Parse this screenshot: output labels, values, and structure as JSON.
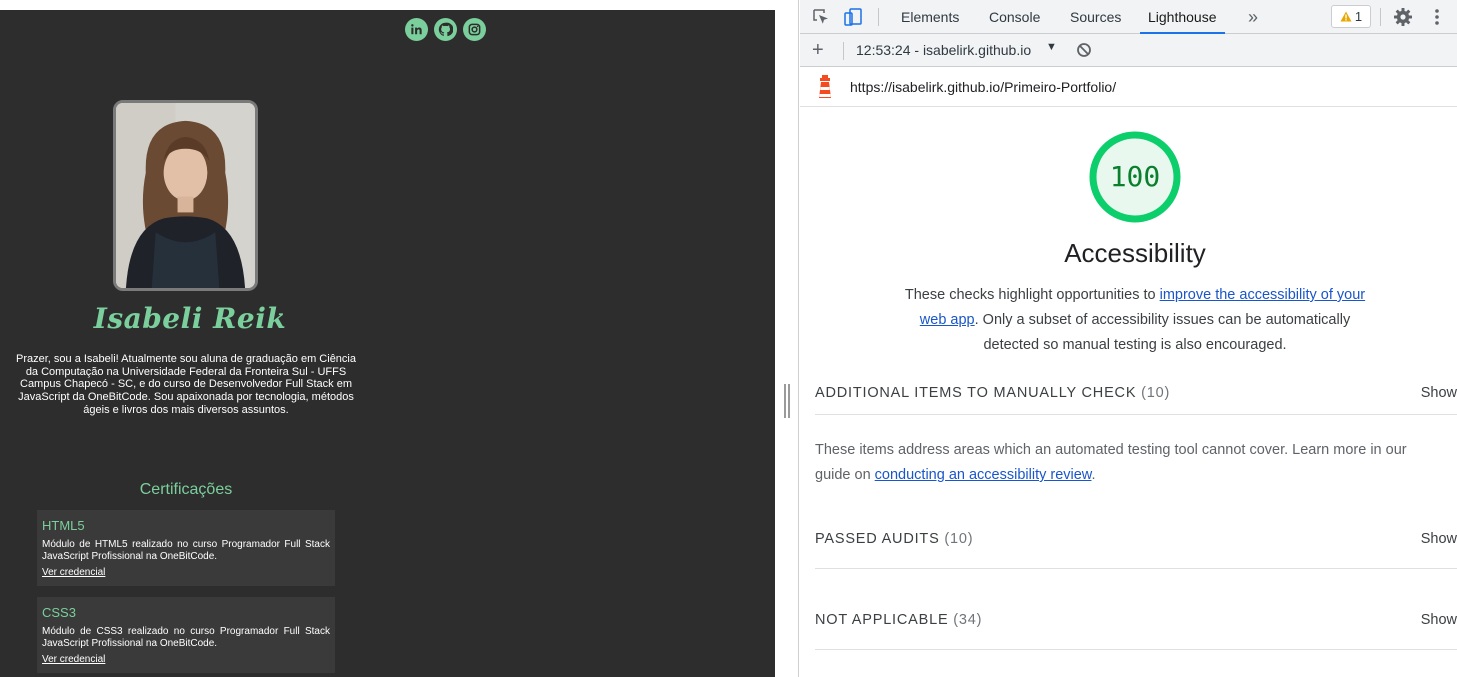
{
  "site": {
    "social": [
      {
        "name": "linkedin-icon",
        "glyph": "in"
      },
      {
        "name": "github-icon",
        "glyph": ""
      },
      {
        "name": "instagram-icon",
        "glyph": ""
      }
    ],
    "name": "Isabeli Reik",
    "bio": "Prazer, sou a Isabeli! Atualmente sou aluna de graduação em Ciência da Computação na Universidade Federal da Fronteira Sul - UFFS Campus Chapecó - SC, e do curso de Desenvolvedor Full Stack em JavaScript da OneBitCode. Sou apaixonada por tecnologia, métodos ágeis e livros dos mais diversos assuntos.",
    "certifications_title": "Certificações",
    "certifications": [
      {
        "name": "HTML5",
        "description": "Módulo de HTML5 realizado no curso Programador Full Stack JavaScript Profissional na OneBitCode.",
        "link": "Ver credencial"
      },
      {
        "name": "CSS3",
        "description": "Módulo de CSS3 realizado no curso Programador Full Stack JavaScript Profissional na OneBitCode.",
        "link": "Ver credencial"
      }
    ],
    "colors": {
      "accent": "#7bcf9c",
      "background": "#2d2d2d",
      "card": "#3a3a3a"
    }
  },
  "devtools": {
    "tabs": [
      {
        "label": "Elements",
        "active": false
      },
      {
        "label": "Console",
        "active": false
      },
      {
        "label": "Sources",
        "active": false
      },
      {
        "label": "Lighthouse",
        "active": true
      }
    ],
    "more_tabs": "»",
    "warning_count": "1",
    "toolbar": {
      "add": "+",
      "report": "12:53:24 - isabelirk.github.io",
      "caret": "▼"
    },
    "url": "https://isabelirk.github.io/Primeiro-Portfolio/",
    "score": {
      "value": "100",
      "fraction": 1.0,
      "category": "Accessibility",
      "desc_before": "These checks highlight opportunities to ",
      "desc_link": "improve the accessibility of your web app",
      "desc_after": ". Only a subset of accessibility issues can be automatically detected so manual testing is also encouraged."
    },
    "groups": {
      "manual": {
        "title": "Additional items to manually check",
        "count": "(10)",
        "show": "Show"
      },
      "manual_desc_before": "These items address areas which an automated testing tool cannot cover. Learn more in our guide on ",
      "manual_desc_link": "conducting an accessibility review",
      "manual_desc_after": ".",
      "passed": {
        "title": "Passed audits",
        "count": "(10)",
        "show": "Show"
      },
      "na": {
        "title": "Not applicable",
        "count": "(34)",
        "show": "Show"
      }
    },
    "colors": {
      "pass": "#0cce6b",
      "pass_text": "#0a7f2e",
      "link": "#1a56c9",
      "active_tab": "#1a73e8"
    }
  }
}
